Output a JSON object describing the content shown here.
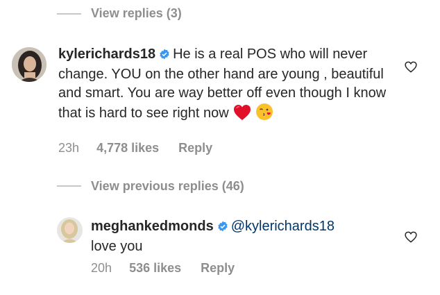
{
  "thread1": {
    "view_replies_label": "View replies (3)"
  },
  "comment1": {
    "username": "kylerichards18",
    "text": "He is a real POS who will never change. YOU on the other hand  are young , beautiful and smart. You are way better off even though I know that is hard to see right now",
    "emojis": [
      "red-heart",
      "face-blowing-kiss"
    ],
    "time": "23h",
    "likes": "4,778 likes",
    "reply_label": "Reply"
  },
  "thread2": {
    "view_previous_label": "View previous replies (46)"
  },
  "comment2": {
    "username": "meghankedmonds",
    "mention": "@kylerichards18",
    "text": "love you",
    "time": "20h",
    "likes": "536 likes",
    "reply_label": "Reply"
  },
  "colors": {
    "text": "#262626",
    "secondary": "#8e8e8e",
    "verified_blue": "#3897f0",
    "mention": "#00376b",
    "divider": "#c7c7c7",
    "heart_red": "#e0102a"
  }
}
